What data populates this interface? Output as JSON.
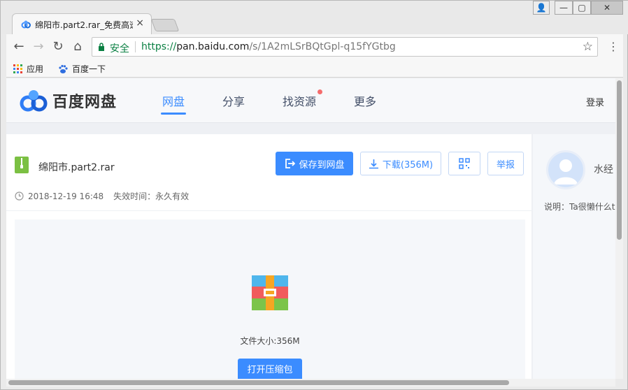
{
  "browser": {
    "tab_title": "绵阳市.part2.rar_免费高速",
    "tab_close": "×",
    "secure_label": "安全",
    "url_scheme": "https://",
    "url_host": "pan.baidu.com",
    "url_path": "/s/1A2mLSrBQtGpl-q15fYGtbg",
    "bookmarks": [
      "应用",
      "百度一下"
    ],
    "window_buttons": {
      "user": "👤",
      "minimize": "—",
      "maximize": "▢",
      "close": "✕"
    }
  },
  "site": {
    "logo_text": "百度网盘",
    "nav": [
      "网盘",
      "分享",
      "找资源",
      "更多"
    ],
    "login": "登录"
  },
  "file": {
    "name": "绵阳市.part2.rar",
    "date": "2018-12-19 16:48",
    "expire": "失效时间：永久有效",
    "save_button": "保存到网盘",
    "download_button": "下载(356M)",
    "report_button": "举报",
    "size_text": "文件大小:356M",
    "open_button": "打开压缩包"
  },
  "user": {
    "name": "水经",
    "desc": "说明：Ta很懒什么t"
  },
  "colors": {
    "accent": "#3b8cff",
    "secure": "#0b8043"
  }
}
